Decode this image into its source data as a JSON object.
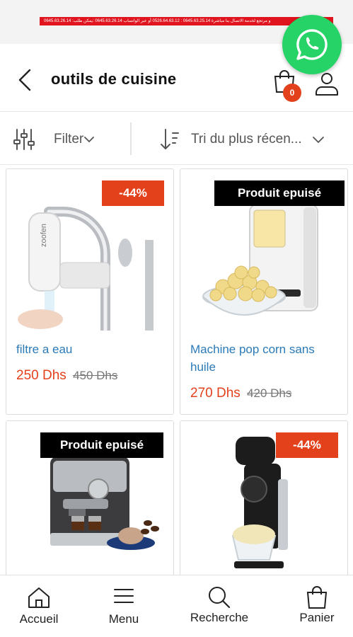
{
  "banner": {
    "text": "0645.63.26.14 :و مرتجع لخدمة الاتصال بنا   مباشرة 0645.63.25.14 : 0526.64.63.12 أو عبر الواتساب   0645.63.26.14 :يمكن طلب"
  },
  "header": {
    "title": "outils de cuisine",
    "cart_count": "0"
  },
  "toolbar": {
    "filter_label": "Filter",
    "sort_label": "Tri du plus récen..."
  },
  "products": [
    {
      "name": "filtre a eau",
      "price": "250",
      "currency": "Dhs",
      "old_price": "450 Dhs",
      "badge": "-44%"
    },
    {
      "name": "Machine pop corn sans huile",
      "price": "270",
      "currency": "Dhs",
      "old_price": "420 Dhs",
      "badge": "Produit epuisé"
    },
    {
      "name": "",
      "price": "",
      "currency": "",
      "old_price": "",
      "badge": "Produit epuisé"
    },
    {
      "name": "",
      "price": "",
      "currency": "",
      "old_price": "",
      "badge": "-44%"
    }
  ],
  "nav": {
    "home": "Accueil",
    "menu": "Menu",
    "search": "Recherche",
    "cart": "Panier"
  },
  "colors": {
    "accent": "#e2411b",
    "link": "#2a7ab8",
    "whatsapp": "#25d366",
    "banner": "#e0141e"
  }
}
